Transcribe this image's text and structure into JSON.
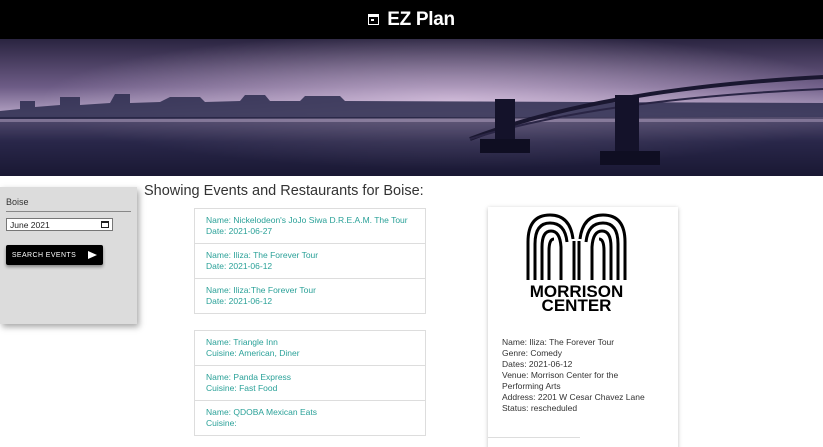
{
  "navbar": {
    "title": "EZ Plan",
    "icon": "calendar-icon"
  },
  "sidebar": {
    "city": "Boise",
    "date_value": "June 2021",
    "search_label": "SEARCH EVENTS"
  },
  "main": {
    "heading": "Showing Events and Restaurants for Boise:",
    "events": [
      {
        "name": "Name: Nickelodeon's JoJo Siwa D.R.E.A.M. The Tour",
        "date": "Date: 2021-06-27"
      },
      {
        "name": "Name: Iliza: The Forever Tour",
        "date": "Date: 2021-06-12"
      },
      {
        "name": "Name: Iliza:The Forever Tour",
        "date": "Date: 2021-06-12"
      }
    ],
    "restaurants": [
      {
        "name": "Name: Triangle Inn",
        "cuisine": "Cuisine: American, Diner"
      },
      {
        "name": "Name: Panda Express",
        "cuisine": "Cuisine: Fast Food"
      },
      {
        "name": "Name: QDOBA Mexican Eats",
        "cuisine": "Cuisine:"
      }
    ]
  },
  "detail": {
    "logo_line1": "MORRISON",
    "logo_line2": "CENTER",
    "name": "Name: Iliza: The Forever Tour",
    "genre": "Genre: Comedy",
    "dates": "Dates: 2021-06-12",
    "venue_line1": "Venue: Morrison Center for the",
    "venue_line2": "Performing Arts",
    "address": "Address: 2201 W Cesar Chavez Lane",
    "status": "Status: rescheduled"
  },
  "colors": {
    "link_teal": "#2aa198",
    "navbar": "#000000",
    "sidebar": "#dcdcdc"
  }
}
